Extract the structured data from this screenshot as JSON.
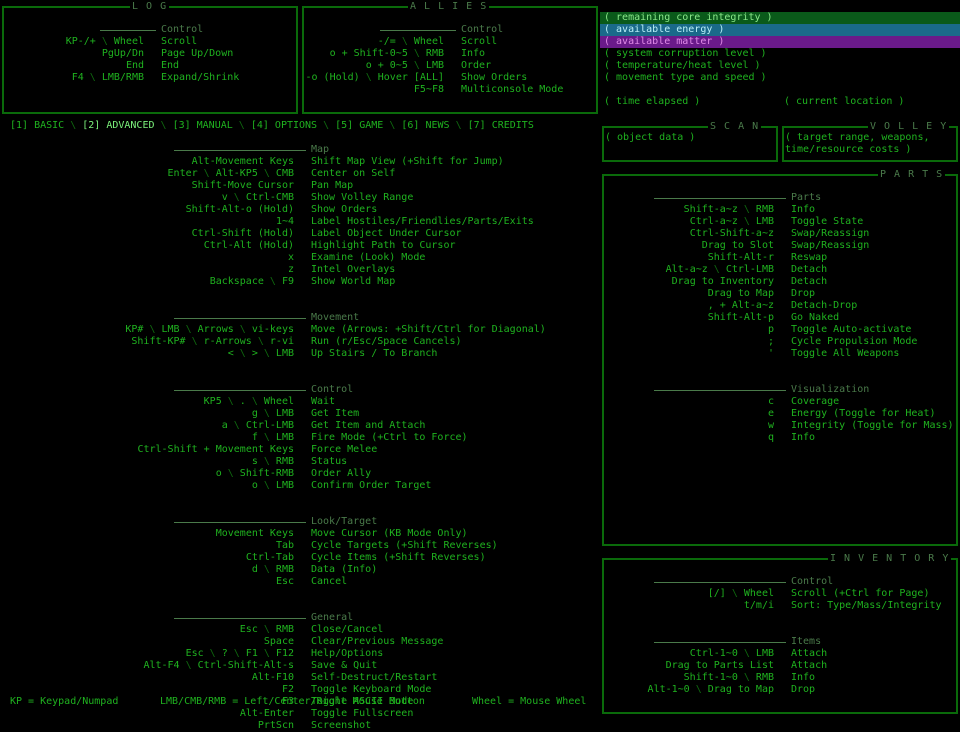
{
  "log": {
    "title": "L O G",
    "section": "Control",
    "rows": [
      {
        "k": "KP-/+ \\ Wheel",
        "d": "Scroll"
      },
      {
        "k": "PgUp/Dn",
        "d": "Page Up/Down"
      },
      {
        "k": "End",
        "d": "End"
      },
      {
        "k": "F4 \\ LMB/RMB",
        "d": "Expand/Shrink"
      }
    ]
  },
  "allies": {
    "title": "A L L I E S",
    "section": "Control",
    "rows": [
      {
        "k": "-/= \\ Wheel",
        "d": "Scroll"
      },
      {
        "k": "o + Shift-0~5 \\ RMB",
        "d": "Info"
      },
      {
        "k": "o + 0~5 \\ LMB",
        "d": "Order"
      },
      {
        "k": "-o (Hold) \\ Hover [ALL]",
        "d": "Show Orders"
      },
      {
        "k": "F5~F8",
        "d": "Multiconsole Mode"
      }
    ]
  },
  "status": {
    "core": "( remaining core integrity )",
    "energy": "( available energy )",
    "matter": "( available matter )",
    "corruption": "( system corruption level )",
    "heat": "( temperature/heat level )",
    "movement": "( movement type and speed )",
    "time": "( time elapsed )",
    "location": "( current location )",
    "colors": {
      "core": "#0a5a1a",
      "energy": "#1a6a8a",
      "matter": "#6a1a8a"
    }
  },
  "tabs": [
    {
      "label": "[1] BASIC",
      "active": false
    },
    {
      "label": "[2] ADVANCED",
      "active": true
    },
    {
      "label": "[3] MANUAL",
      "active": false
    },
    {
      "label": "[4] OPTIONS",
      "active": false
    },
    {
      "label": "[5] GAME",
      "active": false
    },
    {
      "label": "[6] NEWS",
      "active": false
    },
    {
      "label": "[7] CREDITS",
      "active": false
    }
  ],
  "scan": {
    "title": "S C A N",
    "text": "( object data )"
  },
  "volley": {
    "title": "V O L L E Y",
    "text1": "( target range, weapons,",
    "text2": "time/resource costs )"
  },
  "parts": {
    "title": "P A R T S",
    "sections": [
      {
        "title": "Parts",
        "rows": [
          {
            "k": "Shift-a~z \\ RMB",
            "d": "Info"
          },
          {
            "k": "Ctrl-a~z \\ LMB",
            "d": "Toggle State"
          },
          {
            "k": "Ctrl-Shift-a~z",
            "d": "Swap/Reassign"
          },
          {
            "k": "Drag to Slot",
            "d": "Swap/Reassign"
          },
          {
            "k": "Shift-Alt-r",
            "d": "Reswap"
          },
          {
            "k": "Alt-a~z \\ Ctrl-LMB",
            "d": "Detach"
          },
          {
            "k": "Drag to Inventory",
            "d": "Detach"
          },
          {
            "k": "Drag to Map",
            "d": "Drop"
          },
          {
            "k": ", + Alt-a~z",
            "d": "Detach-Drop"
          },
          {
            "k": "Shift-Alt-p",
            "d": "Go Naked"
          },
          {
            "k": "p",
            "d": "Toggle Auto-activate"
          },
          {
            "k": ";",
            "d": "Cycle Propulsion Mode"
          },
          {
            "k": "'",
            "d": "Toggle All Weapons"
          }
        ]
      },
      {
        "title": "Visualization",
        "rows": [
          {
            "k": "c",
            "d": "Coverage"
          },
          {
            "k": "e",
            "d": "Energy (Toggle for Heat)"
          },
          {
            "k": "w",
            "d": "Integrity (Toggle for Mass)"
          },
          {
            "k": "q",
            "d": "Info"
          }
        ]
      }
    ]
  },
  "inventory": {
    "title": "I N V E N T O R Y",
    "sections": [
      {
        "title": "Control",
        "rows": [
          {
            "k": "[/] \\ Wheel",
            "d": "Scroll (+Ctrl for Page)"
          },
          {
            "k": "t/m/i",
            "d": "Sort: Type/Mass/Integrity"
          }
        ]
      },
      {
        "title": "Items",
        "rows": [
          {
            "k": "Ctrl-1~0 \\ LMB",
            "d": "Attach"
          },
          {
            "k": "Drag to Parts List",
            "d": "Attach"
          },
          {
            "k": "Shift-1~0 \\ RMB",
            "d": "Info"
          },
          {
            "k": "Alt-1~0 \\ Drag to Map",
            "d": "Drop"
          }
        ]
      }
    ]
  },
  "main": {
    "sections": [
      {
        "title": "Map",
        "rows": [
          {
            "k": "Alt-Movement Keys",
            "d": "Shift Map View (+Shift for Jump)"
          },
          {
            "k": "Enter \\ Alt-KP5 \\ CMB",
            "d": "Center on Self"
          },
          {
            "k": "Shift-Move Cursor",
            "d": "Pan Map"
          },
          {
            "k": "v \\ Ctrl-CMB",
            "d": "Show Volley Range"
          },
          {
            "k": "Shift-Alt-o (Hold)",
            "d": "Show Orders"
          },
          {
            "k": "1~4",
            "d": "Label Hostiles/Friendlies/Parts/Exits"
          },
          {
            "k": "Ctrl-Shift (Hold)",
            "d": "Label Object Under Cursor"
          },
          {
            "k": "Ctrl-Alt (Hold)",
            "d": "Highlight Path to Cursor"
          },
          {
            "k": "x",
            "d": "Examine (Look) Mode"
          },
          {
            "k": "z",
            "d": "Intel Overlays"
          },
          {
            "k": "Backspace \\ F9",
            "d": "Show World Map"
          }
        ]
      },
      {
        "title": "Movement",
        "rows": [
          {
            "k": "KP# \\ LMB \\ Arrows \\ vi-keys",
            "d": "Move (Arrows: +Shift/Ctrl for Diagonal)"
          },
          {
            "k": "Shift-KP# \\ r-Arrows \\ r-vi",
            "d": "Run (r/Esc/Space Cancels)"
          },
          {
            "k": "< \\ > \\ LMB",
            "d": "Up Stairs / To Branch"
          }
        ]
      },
      {
        "title": "Control",
        "rows": [
          {
            "k": "KP5 \\ . \\ Wheel",
            "d": "Wait"
          },
          {
            "k": "g \\ LMB",
            "d": "Get Item"
          },
          {
            "k": "a \\ Ctrl-LMB",
            "d": "Get Item and Attach"
          },
          {
            "k": "f \\ LMB",
            "d": "Fire Mode (+Ctrl to Force)"
          },
          {
            "k": "Ctrl-Shift + Movement Keys",
            "d": "Force Melee"
          },
          {
            "k": "s \\ RMB",
            "d": "Status"
          },
          {
            "k": "o \\ Shift-RMB",
            "d": "Order Ally"
          },
          {
            "k": "o \\ LMB",
            "d": "Confirm Order Target"
          }
        ]
      },
      {
        "title": "Look/Target",
        "rows": [
          {
            "k": "Movement Keys",
            "d": "Move Cursor (KB Mode Only)"
          },
          {
            "k": "Tab",
            "d": "Cycle Targets (+Shift Reverses)"
          },
          {
            "k": "Ctrl-Tab",
            "d": "Cycle Items (+Shift Reverses)"
          },
          {
            "k": "d \\ RMB",
            "d": "Data (Info)"
          },
          {
            "k": "Esc",
            "d": "Cancel"
          }
        ]
      },
      {
        "title": "General",
        "rows": [
          {
            "k": "Esc \\ RMB",
            "d": "Close/Cancel"
          },
          {
            "k": "Space",
            "d": "Clear/Previous Message"
          },
          {
            "k": "Esc \\ ? \\ F1 \\ F12",
            "d": "Help/Options"
          },
          {
            "k": "Alt-F4 \\ Ctrl-Shift-Alt-s",
            "d": "Save & Quit"
          },
          {
            "k": "Alt-F10",
            "d": "Self-Destruct/Restart"
          },
          {
            "k": "F2",
            "d": "Toggle Keyboard Mode"
          },
          {
            "k": "F3",
            "d": "Toggle ASCII Mode"
          },
          {
            "k": "Alt-Enter",
            "d": "Toggle Fullscreen"
          },
          {
            "k": "PrtScn",
            "d": "Screenshot"
          }
        ]
      }
    ]
  },
  "footer": {
    "kp": "KP = Keypad/Numpad",
    "mouse": "LMB/CMB/RMB = Left/Center/Right Mouse Button",
    "wheel": "Wheel = Mouse Wheel"
  }
}
